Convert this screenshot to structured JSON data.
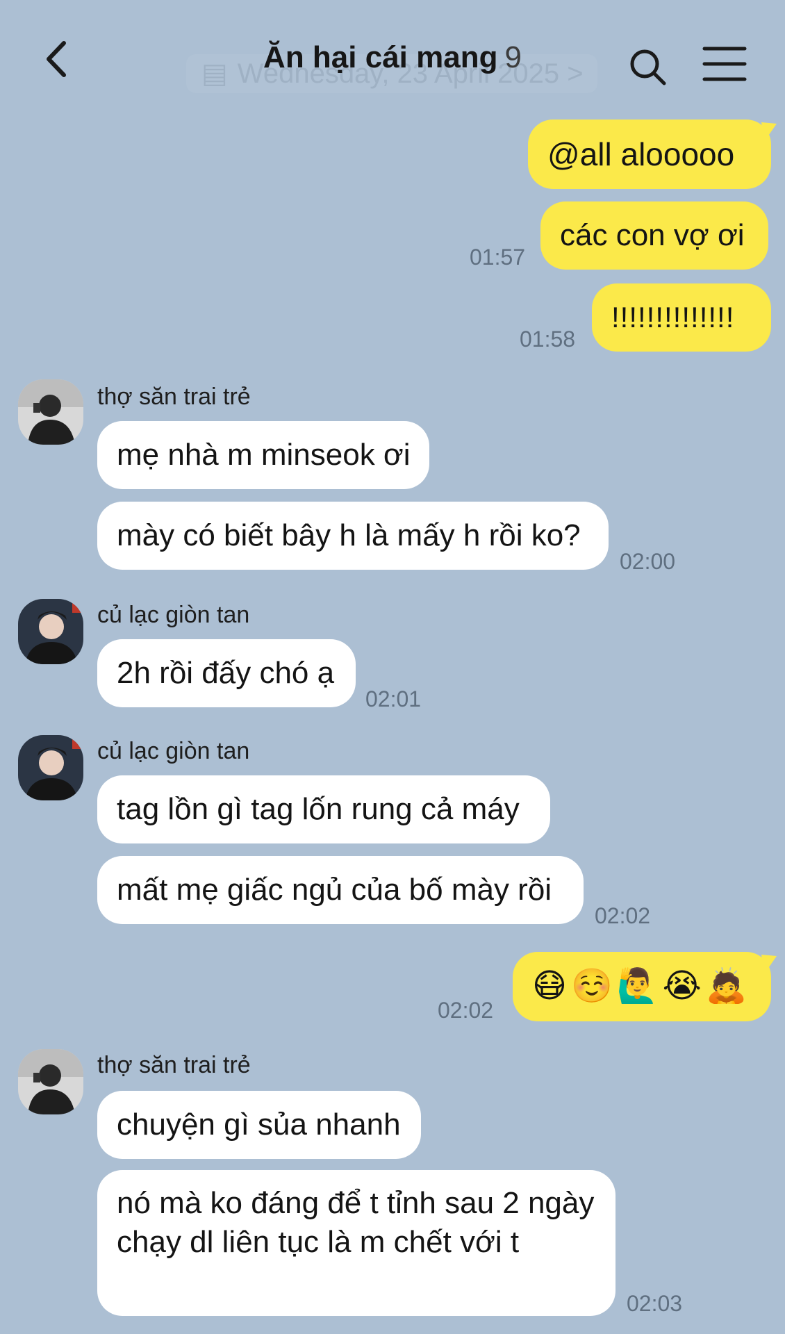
{
  "header": {
    "title": "Ăn hại cái mang",
    "member_count": "9",
    "date_pill": "Wednesday, 23 April 2025 >",
    "icons": [
      "back-icon",
      "search-icon",
      "menu-icon"
    ]
  },
  "messages": [
    {
      "dir": "out",
      "text": "@all alooooo"
    },
    {
      "dir": "out",
      "text": "các con vợ ơi",
      "time": "01:57"
    },
    {
      "dir": "out",
      "text": "!!!!!!!!!!!!!!",
      "time": "01:58"
    },
    {
      "dir": "in",
      "sender": "thợ săn trai trẻ",
      "text": "mẹ nhà m minseok ơi"
    },
    {
      "dir": "in",
      "text": "mày có biết bây h là mấy h rồi ko?",
      "time": "02:00"
    },
    {
      "dir": "in",
      "sender": "củ lạc giòn tan",
      "text": "2h rồi đấy chó ạ",
      "time": "02:01"
    },
    {
      "dir": "in",
      "sender": "củ lạc giòn tan",
      "text": "tag lồn gì tag lốn rung cả máy"
    },
    {
      "dir": "in",
      "text": "mất mẹ giấc ngủ của bố mày rồi",
      "time": "02:02"
    },
    {
      "dir": "out",
      "text": "😷☺️🙋‍♂️😭🙇",
      "time": "02:02"
    },
    {
      "dir": "in",
      "sender": "thợ săn trai trẻ",
      "text": "chuyện gì sủa nhanh"
    },
    {
      "dir": "in",
      "text": "nó mà ko đáng để t tỉnh sau 2 ngày chạy dl liên tục là m chết với t",
      "time": "02:03"
    }
  ],
  "colors": {
    "background": "#acbfd3",
    "outgoing_bubble": "#fbe94a",
    "incoming_bubble": "#ffffff",
    "timestamp": "#5f6f80"
  }
}
